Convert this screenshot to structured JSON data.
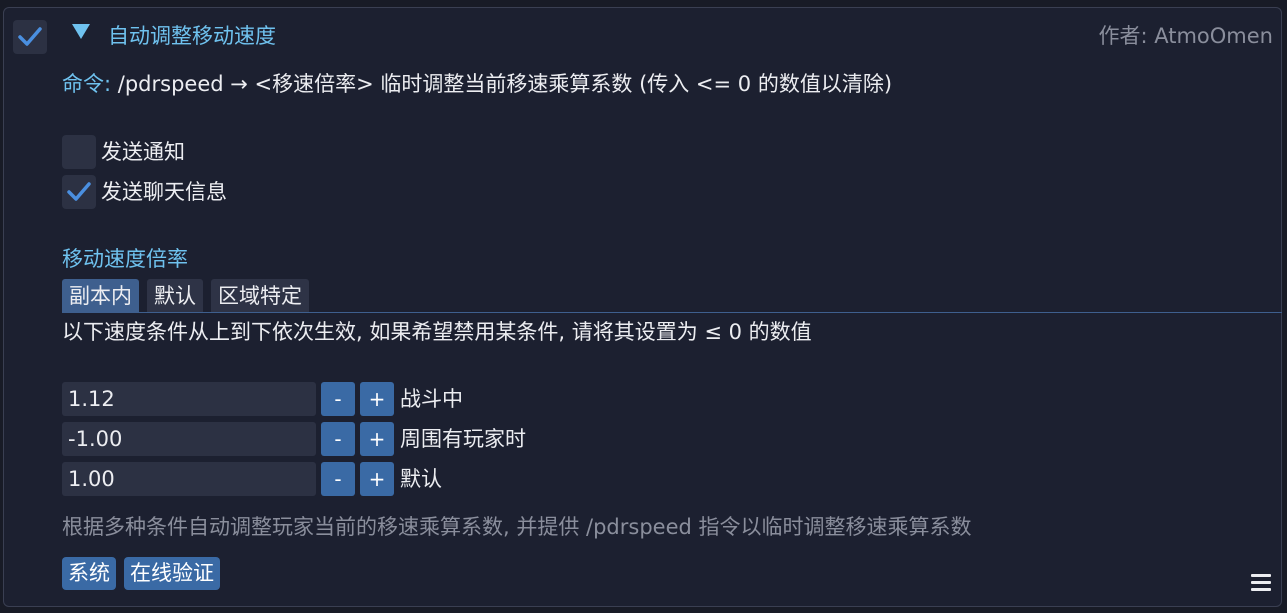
{
  "header": {
    "enabled": true,
    "title": "自动调整移动速度",
    "author": "作者: AtmoOmen"
  },
  "command": {
    "label": "命令:",
    "text": "/pdrspeed → <移速倍率> 临时调整当前移速乘算系数 (传入 <= 0 的数值以清除)"
  },
  "options": [
    {
      "label": "发送通知",
      "checked": false
    },
    {
      "label": "发送聊天信息",
      "checked": true
    }
  ],
  "section_title": "移动速度倍率",
  "tabs": [
    {
      "label": "副本内",
      "active": true
    },
    {
      "label": "默认",
      "active": false
    },
    {
      "label": "区域特定",
      "active": false
    }
  ],
  "hint": "以下速度条件从上到下依次生效, 如果希望禁用某条件, 请将其设置为 ≤ 0 的数值",
  "conditions": [
    {
      "value": "1.12",
      "label": "战斗中"
    },
    {
      "value": "-1.00",
      "label": "周围有玩家时"
    },
    {
      "value": "1.00",
      "label": "默认"
    }
  ],
  "stepper": {
    "minus": "-",
    "plus": "+"
  },
  "description": "根据多种条件自动调整玩家当前的移速乘算系数, 并提供 /pdrspeed 指令以临时调整移速乘算系数",
  "tags": [
    "系统",
    "在线验证"
  ],
  "icons": {
    "enable": "checkmark-icon",
    "collapse": "triangle-down-icon",
    "menu": "hamburger-menu-icon"
  },
  "colors": {
    "accent": "#6fc2ef",
    "button": "#3a6aa5",
    "check": "#4a8fe0"
  }
}
